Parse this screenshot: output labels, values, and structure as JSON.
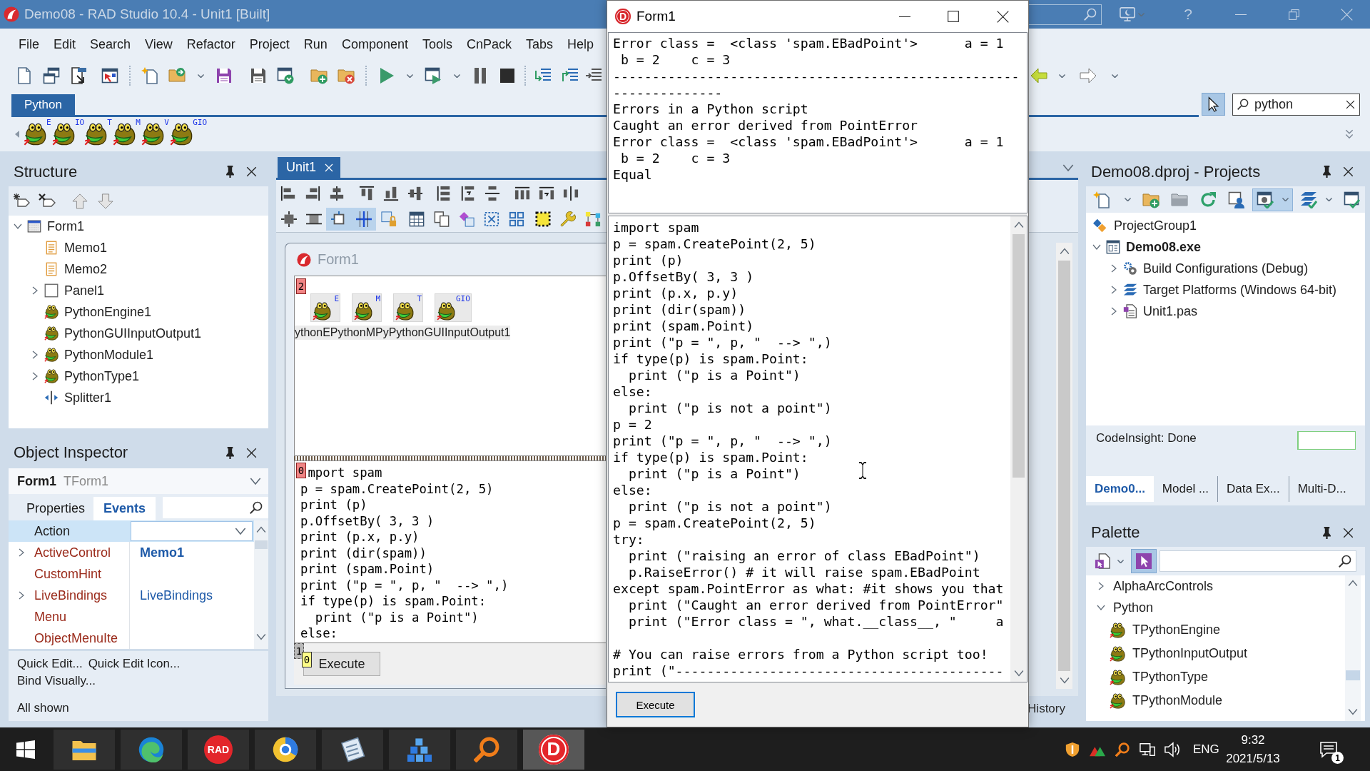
{
  "ide": {
    "title": "Demo08 - RAD Studio 10.4 - Unit1 [Built]",
    "help": "?",
    "menu": [
      "File",
      "Edit",
      "Search",
      "View",
      "Refactor",
      "Project",
      "Run",
      "Component",
      "Tools",
      "CnPack",
      "Tabs",
      "Help"
    ],
    "palette_bar": {
      "tabs": [
        {
          "label": "Python",
          "selected": true
        }
      ],
      "pointer_tool": {
        "on": true
      },
      "search": {
        "value": "python"
      },
      "components": [
        {
          "tag": "E"
        },
        {
          "tag": "IO"
        },
        {
          "tag": "T"
        },
        {
          "tag": "M"
        },
        {
          "tag": "V"
        },
        {
          "tag": "GIO"
        }
      ]
    },
    "structure": {
      "title": "Structure",
      "tree": [
        {
          "label": "Form1",
          "kind": "form",
          "expanded": true,
          "children": [
            {
              "label": "Memo1",
              "kind": "memo"
            },
            {
              "label": "Memo2",
              "kind": "memo"
            },
            {
              "label": "Panel1",
              "kind": "panel",
              "expanded": false
            },
            {
              "label": "PythonEngine1",
              "kind": "python"
            },
            {
              "label": "PythonGUIInputOutput1",
              "kind": "python"
            },
            {
              "label": "PythonModule1",
              "kind": "python",
              "expanded": false
            },
            {
              "label": "PythonType1",
              "kind": "python",
              "expanded": false
            },
            {
              "label": "Splitter1",
              "kind": "splitter"
            }
          ]
        }
      ]
    },
    "object_inspector": {
      "title": "Object Inspector",
      "object": "Form1",
      "object_class": "TForm1",
      "tabs": [
        {
          "label": "Properties",
          "selected": false
        },
        {
          "label": "Events",
          "selected": true
        }
      ],
      "rows": [
        {
          "name": "Action",
          "selected": true
        },
        {
          "name": "ActiveControl",
          "value": "Memo1",
          "expanded": false,
          "modified": true,
          "selected": false
        },
        {
          "name": "CustomHint",
          "selected": false
        },
        {
          "name": "LiveBindings",
          "value": "LiveBindings",
          "expanded": false,
          "modified": false,
          "selected": false
        },
        {
          "name": "Menu",
          "selected": false
        },
        {
          "name": "ObjectMenuIte",
          "selected": false
        }
      ],
      "links": [
        "Quick Edit...",
        "Quick Edit Icon...",
        "Bind Visually..."
      ],
      "status": "All shown"
    },
    "designer": {
      "tabs": [
        {
          "label": "Unit1",
          "selected": true
        }
      ],
      "layout_tools": [
        {
          "on": false
        },
        {
          "on": false
        },
        {
          "on": true
        },
        {
          "on": true
        },
        {
          "on": false
        },
        {
          "on": false
        },
        {
          "on": false
        },
        {
          "on": false
        },
        {
          "on": false
        },
        {
          "on": false
        },
        {
          "on": false
        },
        {
          "on": false
        },
        {
          "on": false
        }
      ],
      "form": {
        "title": "Form1",
        "panel": {
          "tab_order": "2",
          "components": [
            {
              "tag": "E"
            },
            {
              "tag": "M"
            },
            {
              "tag": "T"
            },
            {
              "tag": "GIO"
            }
          ],
          "captions": "ythonEPythonMPyPythonGUIInputOutput1"
        },
        "memo": {
          "tab_order": "0",
          "text": "mport spam\np = spam.CreatePoint(2, 5)\nprint (p)\np.OffsetBy( 3, 3 )\nprint (p.x, p.y)\nprint (dir(spam))\nprint (spam.Point)\nprint (\"p = \", p, \"  --> \",)\nif type(p) is spam.Point:\n  print (\"p is a Point\")\nelse:"
        },
        "button_panel": {
          "tab_order": "1",
          "button": {
            "label": "Execute",
            "tab_order": "0"
          }
        }
      },
      "bottom_tab": "History"
    },
    "projects": {
      "title": "Demo08.dproj - Projects",
      "tools": [
        {
          "on": false
        },
        {
          "on": false
        },
        {
          "on": false
        },
        {
          "on": false
        },
        {
          "on": false
        },
        {
          "on": true
        },
        {
          "on": false
        },
        {
          "on": false
        }
      ],
      "tree": [
        {
          "label": "ProjectGroup1",
          "kind": "group",
          "active": false,
          "children": [
            {
              "label": "Demo08.exe",
              "kind": "exe",
              "active": true,
              "expanded": true,
              "children": [
                {
                  "label": "Build Configurations (Debug)",
                  "kind": "config",
                  "active": false,
                  "expanded": false
                },
                {
                  "label": "Target Platforms (Windows 64-bit)",
                  "kind": "platforms",
                  "active": false,
                  "expanded": false
                },
                {
                  "label": "Unit1.pas",
                  "kind": "unit",
                  "active": false,
                  "expanded": false
                }
              ]
            }
          ]
        }
      ],
      "status": "CodeInsight: Done",
      "progress": {
        "level": 0
      },
      "tabs": [
        {
          "label": "Demo0...",
          "selected": true
        },
        {
          "label": "Model ...",
          "selected": false
        },
        {
          "label": "Data Ex...",
          "selected": false
        },
        {
          "label": "Multi-D...",
          "selected": false
        }
      ]
    },
    "palette": {
      "title": "Palette",
      "pointer_tool": {
        "on": true
      },
      "groups": [
        {
          "label": "AlphaArcControls",
          "expanded": false
        },
        {
          "label": "Python",
          "expanded": true,
          "children": [
            {
              "label": "TPythonEngine"
            },
            {
              "label": "TPythonInputOutput"
            },
            {
              "label": "TPythonType"
            },
            {
              "label": "TPythonModule"
            }
          ]
        }
      ]
    }
  },
  "app_window": {
    "logo": "D",
    "title": "Form1",
    "output": "Error class =  <class 'spam.EBadPoint'>      a = 1\n b = 2    c = 3\n----------------------------------------------------\n--------------\nErrors in a Python script\nCaught an error derived from PointError\nError class =  <class 'spam.EBadPoint'>      a = 1\n b = 2    c = 3\nEqual",
    "code": "import spam\np = spam.CreatePoint(2, 5)\nprint (p)\np.OffsetBy( 3, 3 )\nprint (p.x, p.y)\nprint (dir(spam))\nprint (spam.Point)\nprint (\"p = \", p, \"  --> \",)\nif type(p) is spam.Point:\n  print (\"p is a Point\")\nelse:\n  print (\"p is not a point\")\np = 2\nprint (\"p = \", p, \"  --> \",)\nif type(p) is spam.Point:\n  print (\"p is a Point\")\nelse:\n  print (\"p is not a point\")\np = spam.CreatePoint(2, 5)\ntry:\n  print (\"raising an error of class EBadPoint\")\n  p.RaiseError() # it will raise spam.EBadPoint\nexcept spam.PointError as what: #it shows you that\n  print (\"Caught an error derived from PointError\"\n  print (\"Error class = \", what.__class__, \"     a\n\n# You can raise errors from a Python script too!\nprint (\"------------------------------------------",
    "button": "Execute"
  },
  "taskbar": {
    "apps": [
      {
        "kind": "explorer",
        "selected": false
      },
      {
        "kind": "edge",
        "selected": false
      },
      {
        "kind": "rad",
        "label": "RAD",
        "selected": false
      },
      {
        "kind": "chrome",
        "selected": false
      },
      {
        "kind": "notepad",
        "selected": false
      },
      {
        "kind": "cubes",
        "selected": false
      },
      {
        "kind": "magnifier",
        "selected": false
      },
      {
        "kind": "delphi",
        "label": "D",
        "selected": true
      }
    ],
    "language": "ENG",
    "time": "9:32",
    "date": "2021/5/13",
    "notifications": "1"
  }
}
